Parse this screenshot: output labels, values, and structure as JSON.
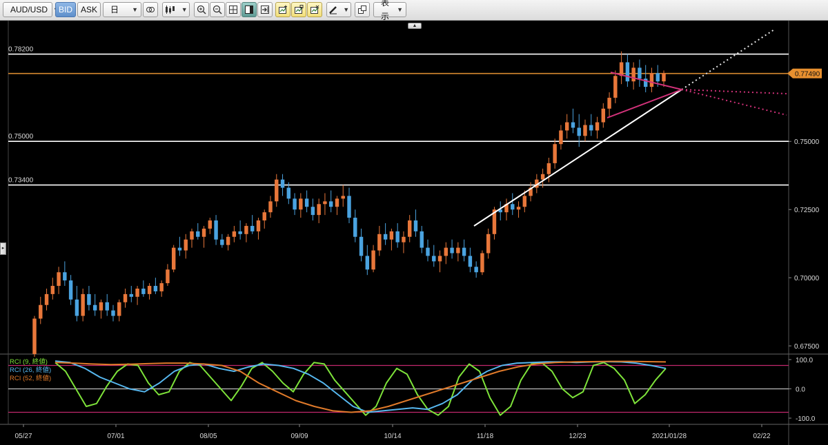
{
  "toolbar": {
    "symbol": "AUD/USD",
    "bid_label": "BID",
    "ask_label": "ASK",
    "timeframe": "日",
    "display_menu_label": "表示"
  },
  "price_axis": {
    "ticks": [
      "0.75000",
      "0.72500",
      "0.70000",
      "0.67500"
    ],
    "current_price_label": "0.77490"
  },
  "horizontal_lines": [
    {
      "label": "0.78200",
      "value": 0.782,
      "color": "#ffffff"
    },
    {
      "label": "0.75000",
      "value": 0.75,
      "color": "#ffffff"
    },
    {
      "label": "0.73400",
      "value": 0.734,
      "color": "#ffffff"
    },
    {
      "value": 0.7749,
      "color": "#d98a2f"
    }
  ],
  "date_axis": {
    "ticks": [
      "05/27",
      "07/01",
      "08/05",
      "09/09",
      "10/14",
      "11/18",
      "12/23",
      "2021/01/28",
      "02/22"
    ]
  },
  "indicator": {
    "legend": [
      {
        "label": "RCI (9, 終値)",
        "color": "#7ee33a"
      },
      {
        "label": "RCI (26, 終値)",
        "color": "#57b8f0"
      },
      {
        "label": "RCI (52, 終値)",
        "color": "#e07a2a"
      }
    ],
    "axis_ticks": [
      "100.0",
      "0.0",
      "-100.0"
    ]
  },
  "colors": {
    "up": "#e8773a",
    "down": "#4aa3e0",
    "background": "#000000",
    "current_price": "#e8902f",
    "trend_pink": "#d2327a",
    "support_white": "#ffffff"
  },
  "chart_data": {
    "type": "candlestick",
    "symbol": "AUD/USD",
    "timeframe": "daily",
    "price_range": [
      0.6725,
      0.7925
    ],
    "last_price": 0.7749,
    "candles": [
      [
        0.672,
        0.686,
        0.671,
        0.685
      ],
      [
        0.685,
        0.693,
        0.683,
        0.69
      ],
      [
        0.69,
        0.696,
        0.688,
        0.694
      ],
      [
        0.694,
        0.7,
        0.692,
        0.697
      ],
      [
        0.697,
        0.704,
        0.694,
        0.702
      ],
      [
        0.702,
        0.706,
        0.697,
        0.699
      ],
      [
        0.699,
        0.701,
        0.69,
        0.692
      ],
      [
        0.692,
        0.697,
        0.684,
        0.686
      ],
      [
        0.686,
        0.696,
        0.684,
        0.694
      ],
      [
        0.694,
        0.697,
        0.688,
        0.69
      ],
      [
        0.69,
        0.694,
        0.686,
        0.688
      ],
      [
        0.688,
        0.692,
        0.685,
        0.691
      ],
      [
        0.691,
        0.694,
        0.686,
        0.688
      ],
      [
        0.688,
        0.69,
        0.684,
        0.686
      ],
      [
        0.686,
        0.692,
        0.684,
        0.691
      ],
      [
        0.691,
        0.696,
        0.689,
        0.694
      ],
      [
        0.694,
        0.697,
        0.691,
        0.693
      ],
      [
        0.693,
        0.697,
        0.69,
        0.696
      ],
      [
        0.696,
        0.699,
        0.693,
        0.694
      ],
      [
        0.694,
        0.698,
        0.692,
        0.697
      ],
      [
        0.697,
        0.7,
        0.694,
        0.695
      ],
      [
        0.695,
        0.699,
        0.693,
        0.698
      ],
      [
        0.698,
        0.705,
        0.697,
        0.703
      ],
      [
        0.703,
        0.712,
        0.702,
        0.711
      ],
      [
        0.711,
        0.715,
        0.708,
        0.71
      ],
      [
        0.71,
        0.716,
        0.707,
        0.714
      ],
      [
        0.714,
        0.718,
        0.711,
        0.717
      ],
      [
        0.717,
        0.72,
        0.714,
        0.715
      ],
      [
        0.715,
        0.719,
        0.711,
        0.718
      ],
      [
        0.718,
        0.722,
        0.716,
        0.721
      ],
      [
        0.721,
        0.723,
        0.712,
        0.714
      ],
      [
        0.714,
        0.716,
        0.711,
        0.712
      ],
      [
        0.712,
        0.716,
        0.71,
        0.715
      ],
      [
        0.715,
        0.719,
        0.713,
        0.717
      ],
      [
        0.717,
        0.721,
        0.714,
        0.716
      ],
      [
        0.716,
        0.72,
        0.713,
        0.719
      ],
      [
        0.719,
        0.723,
        0.716,
        0.717
      ],
      [
        0.717,
        0.722,
        0.714,
        0.721
      ],
      [
        0.721,
        0.725,
        0.718,
        0.724
      ],
      [
        0.724,
        0.73,
        0.722,
        0.728
      ],
      [
        0.728,
        0.738,
        0.726,
        0.736
      ],
      [
        0.736,
        0.738,
        0.73,
        0.733
      ],
      [
        0.733,
        0.735,
        0.727,
        0.729
      ],
      [
        0.729,
        0.731,
        0.723,
        0.725
      ],
      [
        0.725,
        0.731,
        0.722,
        0.729
      ],
      [
        0.729,
        0.732,
        0.724,
        0.726
      ],
      [
        0.726,
        0.729,
        0.721,
        0.723
      ],
      [
        0.723,
        0.729,
        0.72,
        0.727
      ],
      [
        0.727,
        0.731,
        0.723,
        0.728
      ],
      [
        0.728,
        0.732,
        0.724,
        0.726
      ],
      [
        0.726,
        0.73,
        0.723,
        0.729
      ],
      [
        0.729,
        0.734,
        0.726,
        0.73
      ],
      [
        0.73,
        0.733,
        0.72,
        0.722
      ],
      [
        0.722,
        0.725,
        0.713,
        0.715
      ],
      [
        0.715,
        0.718,
        0.706,
        0.708
      ],
      [
        0.708,
        0.712,
        0.701,
        0.703
      ],
      [
        0.703,
        0.712,
        0.702,
        0.71
      ],
      [
        0.71,
        0.719,
        0.708,
        0.716
      ],
      [
        0.716,
        0.72,
        0.712,
        0.714
      ],
      [
        0.714,
        0.718,
        0.71,
        0.717
      ],
      [
        0.717,
        0.72,
        0.711,
        0.713
      ],
      [
        0.713,
        0.717,
        0.709,
        0.715
      ],
      [
        0.715,
        0.723,
        0.713,
        0.721
      ],
      [
        0.721,
        0.725,
        0.715,
        0.717
      ],
      [
        0.717,
        0.719,
        0.709,
        0.711
      ],
      [
        0.711,
        0.714,
        0.706,
        0.708
      ],
      [
        0.708,
        0.712,
        0.704,
        0.706
      ],
      [
        0.706,
        0.71,
        0.702,
        0.708
      ],
      [
        0.708,
        0.713,
        0.705,
        0.711
      ],
      [
        0.711,
        0.714,
        0.707,
        0.709
      ],
      [
        0.709,
        0.713,
        0.706,
        0.711
      ],
      [
        0.711,
        0.714,
        0.706,
        0.708
      ],
      [
        0.708,
        0.711,
        0.702,
        0.704
      ],
      [
        0.704,
        0.706,
        0.7,
        0.702
      ],
      [
        0.702,
        0.71,
        0.701,
        0.709
      ],
      [
        0.709,
        0.718,
        0.707,
        0.716
      ],
      [
        0.716,
        0.726,
        0.714,
        0.725
      ],
      [
        0.725,
        0.728,
        0.721,
        0.724
      ],
      [
        0.724,
        0.729,
        0.721,
        0.727
      ],
      [
        0.727,
        0.731,
        0.723,
        0.725
      ],
      [
        0.725,
        0.728,
        0.722,
        0.726
      ],
      [
        0.726,
        0.732,
        0.724,
        0.73
      ],
      [
        0.73,
        0.735,
        0.728,
        0.733
      ],
      [
        0.733,
        0.738,
        0.731,
        0.736
      ],
      [
        0.736,
        0.74,
        0.733,
        0.738
      ],
      [
        0.738,
        0.744,
        0.735,
        0.742
      ],
      [
        0.742,
        0.751,
        0.74,
        0.749
      ],
      [
        0.749,
        0.756,
        0.747,
        0.754
      ],
      [
        0.754,
        0.76,
        0.751,
        0.757
      ],
      [
        0.757,
        0.762,
        0.753,
        0.755
      ],
      [
        0.755,
        0.76,
        0.748,
        0.752
      ],
      [
        0.752,
        0.758,
        0.75,
        0.756
      ],
      [
        0.756,
        0.76,
        0.752,
        0.754
      ],
      [
        0.754,
        0.759,
        0.751,
        0.757
      ],
      [
        0.757,
        0.764,
        0.755,
        0.762
      ],
      [
        0.762,
        0.768,
        0.759,
        0.766
      ],
      [
        0.766,
        0.776,
        0.764,
        0.774
      ],
      [
        0.774,
        0.783,
        0.771,
        0.779
      ],
      [
        0.779,
        0.782,
        0.77,
        0.772
      ],
      [
        0.772,
        0.779,
        0.769,
        0.777
      ],
      [
        0.777,
        0.78,
        0.77,
        0.773
      ],
      [
        0.773,
        0.778,
        0.768,
        0.77
      ],
      [
        0.77,
        0.777,
        0.768,
        0.775
      ],
      [
        0.775,
        0.778,
        0.77,
        0.772
      ],
      [
        0.772,
        0.776,
        0.77,
        0.775
      ]
    ],
    "rci": {
      "range": [
        -100,
        100
      ],
      "levels": [
        80,
        0,
        -80
      ],
      "series": [
        {
          "name": "RCI (9, 終値)",
          "color": "#7ee33a",
          "values": [
            90,
            60,
            0,
            -60,
            -50,
            10,
            60,
            85,
            80,
            20,
            -20,
            -10,
            60,
            90,
            80,
            40,
            0,
            -40,
            10,
            70,
            90,
            60,
            20,
            -10,
            50,
            90,
            85,
            30,
            -10,
            -50,
            -90,
            -60,
            20,
            70,
            50,
            -20,
            -70,
            -90,
            -60,
            40,
            85,
            60,
            -30,
            -90,
            -60,
            30,
            85,
            90,
            60,
            0,
            -30,
            -10,
            80,
            90,
            70,
            30,
            -50,
            -20,
            30,
            70
          ]
        },
        {
          "name": "RCI (26, 終値)",
          "color": "#57b8f0",
          "values": [
            95,
            90,
            70,
            40,
            20,
            0,
            -10,
            20,
            60,
            80,
            85,
            70,
            60,
            75,
            85,
            80,
            70,
            50,
            20,
            -20,
            -60,
            -80,
            -75,
            -70,
            -65,
            -70,
            -50,
            -20,
            30,
            60,
            80,
            88,
            90,
            92,
            92,
            90,
            92,
            93,
            92,
            88,
            80,
            70
          ]
        },
        {
          "name": "RCI (52, 終値)",
          "color": "#e07a2a",
          "values": [
            90,
            88,
            85,
            83,
            84,
            86,
            88,
            88,
            85,
            80,
            60,
            20,
            -10,
            -40,
            -60,
            -75,
            -80,
            -75,
            -60,
            -40,
            -20,
            0,
            20,
            40,
            60,
            75,
            85,
            90,
            92,
            93,
            94,
            94,
            93,
            92
          ]
        }
      ]
    }
  }
}
